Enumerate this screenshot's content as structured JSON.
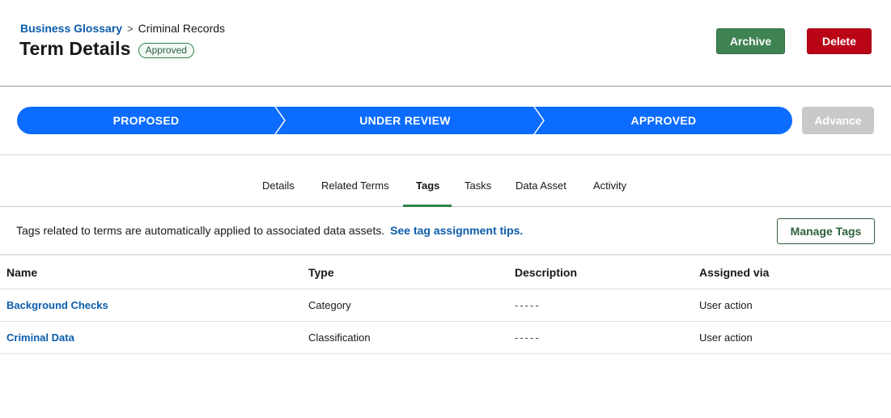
{
  "header": {
    "breadcrumb": {
      "parent": "Business Glossary",
      "separator": ">",
      "current": "Criminal Records"
    },
    "title": "Term Details",
    "status_badge": "Approved",
    "archive_label": "Archive",
    "delete_label": "Delete"
  },
  "path": {
    "stages": [
      {
        "label": "PROPOSED"
      },
      {
        "label": "UNDER REVIEW"
      },
      {
        "label": "APPROVED"
      }
    ],
    "advance_label": "Advance",
    "colors": {
      "stage": "#0b6cff",
      "advance_disabled": "#c9c9c9"
    }
  },
  "tabs": [
    {
      "label": "Details",
      "active": false
    },
    {
      "label": "Related Terms",
      "active": false
    },
    {
      "label": "Tags",
      "active": true
    },
    {
      "label": "Tasks",
      "active": false
    },
    {
      "label": "Data Asset",
      "active": false
    },
    {
      "label": "Activity",
      "active": false
    }
  ],
  "info": {
    "text": "Tags related to terms are automatically applied to associated data assets.",
    "link": "See tag assignment tips.",
    "manage_label": "Manage Tags"
  },
  "table": {
    "columns": [
      "Name",
      "Type",
      "Description",
      "Assigned via"
    ],
    "rows": [
      {
        "name": "Background Checks",
        "type": "Category",
        "description": "-----",
        "assigned_via": "User action"
      },
      {
        "name": "Criminal Data",
        "type": "Classification",
        "description": "-----",
        "assigned_via": "User action"
      }
    ]
  },
  "colors": {
    "accent": "#2e844a",
    "link": "#0b5cab",
    "danger": "#ba0517"
  }
}
